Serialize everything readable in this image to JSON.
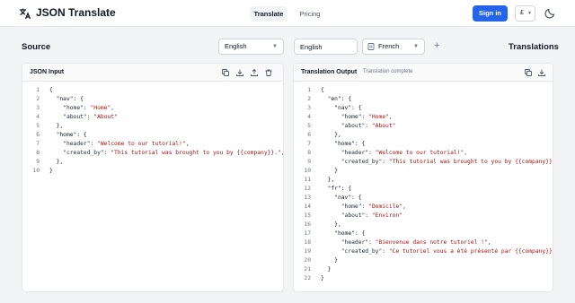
{
  "app": {
    "title": "JSON Translate"
  },
  "nav": {
    "tabs": [
      {
        "label": "Translate",
        "active": true
      },
      {
        "label": "Pricing",
        "active": false
      }
    ]
  },
  "header": {
    "signin_label": "Sign in",
    "currency_value": "£"
  },
  "toolbar": {
    "source_title": "Source",
    "source_language": "English",
    "source_lang_input": "English",
    "target_language": "French",
    "translations_title": "Translations"
  },
  "input_panel": {
    "title": "JSON Input",
    "lines": [
      "{",
      "  \"nav\": {",
      "    \"home\": \"Home\",",
      "    \"about\": \"About\"",
      "  },",
      "  \"home\": {",
      "    \"header\": \"Welcome to our tutorial!\",",
      "    \"created_by\": \"This tutorial was brought to you by {{company}}.\",",
      "  },",
      "}"
    ]
  },
  "output_panel": {
    "title": "Translation Output",
    "status": "Translation complete",
    "lines": [
      "{",
      "  \"en\": {",
      "    \"nav\": {",
      "      \"home\": \"Home\",",
      "      \"about\": \"About\"",
      "    },",
      "    \"home\": {",
      "      \"header\": \"Welcome to our tutorial!\",",
      "      \"created_by\": \"This tutorial was brought to you by {{company}}.\"",
      "    }",
      "  },",
      "  \"fr\": {",
      "    \"nav\": {",
      "      \"home\": \"Domicile\",",
      "      \"about\": \"Environ\"",
      "    },",
      "    \"home\": {",
      "      \"header\": \"Bienvenue dans notre tutoriel !\",",
      "      \"created_by\": \"Ce tutoriel vous a été présenté par {{company}}.\"",
      "    }",
      "  }",
      "}"
    ]
  },
  "colors": {
    "accent": "#2563eb",
    "string": "#a31515",
    "border": "#e5e7eb",
    "background": "#f3f4f6"
  }
}
